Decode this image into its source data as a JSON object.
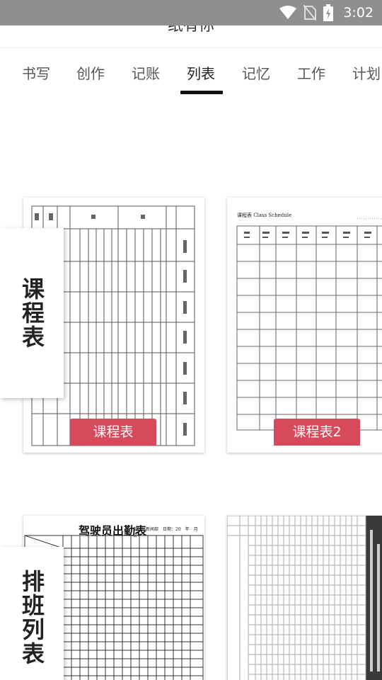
{
  "status_bar": {
    "time": "3:02",
    "icons": [
      "wifi-icon",
      "no-sim-icon",
      "battery-charging-icon"
    ]
  },
  "header": {
    "title": "纸有你"
  },
  "tabs": [
    {
      "label": "书写",
      "active": false
    },
    {
      "label": "创作",
      "active": false
    },
    {
      "label": "记账",
      "active": false
    },
    {
      "label": "列表",
      "active": true
    },
    {
      "label": "记忆",
      "active": false
    },
    {
      "label": "工作",
      "active": false
    },
    {
      "label": "计划",
      "active": false
    }
  ],
  "sections": [
    {
      "category": "课程表",
      "templates": [
        {
          "button_label": "课程表"
        },
        {
          "button_label": "课程表2",
          "heading": "课程表 Class Schedule",
          "columns": [
            "节次 Time",
            "星期一 Mon",
            "星期二 Tue",
            "星期三 Wed",
            "星期四 Thu",
            "星期五 Fri",
            "星期六 Sat"
          ]
        }
      ]
    },
    {
      "category": "排班列表",
      "templates": [
        {
          "heading": "驾驶员出勤表",
          "sub": "部门：新闻部　日期：20　年　月　日"
        },
        {}
      ]
    }
  ],
  "colors": {
    "accent": "#d64a5c",
    "status_bar": "#8f8f8f",
    "tab_indicator": "#111111"
  }
}
